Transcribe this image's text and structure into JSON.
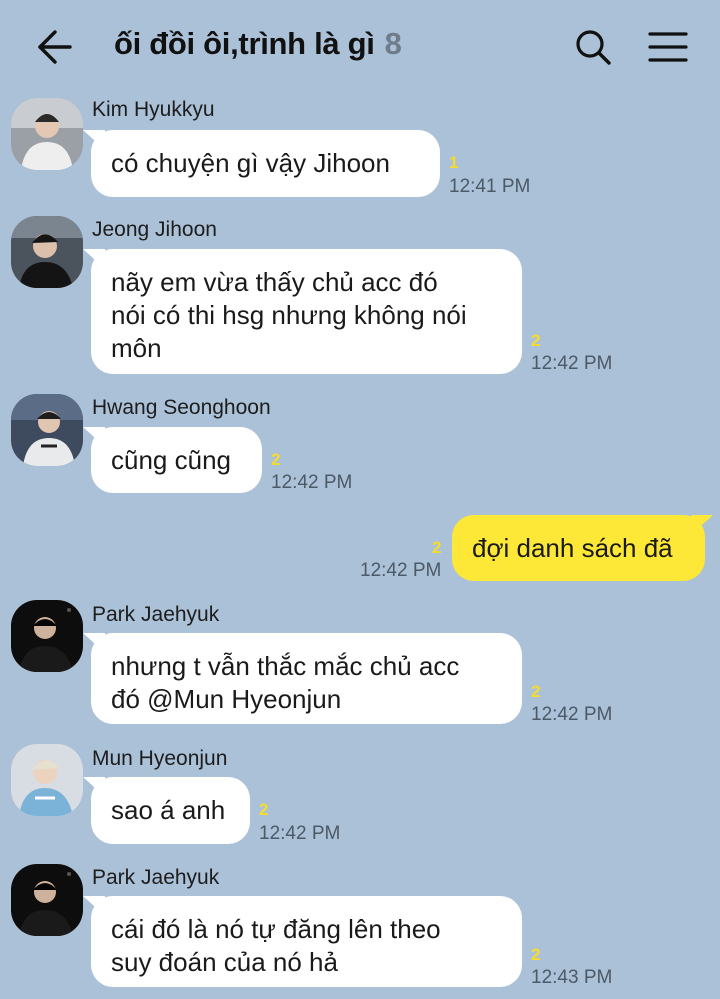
{
  "header": {
    "title": "ối đồi ôi,trình là gì",
    "member_count": "8",
    "back_icon": "arrow-left-icon",
    "search_icon": "search-icon",
    "menu_icon": "hamburger-menu-icon"
  },
  "colors": {
    "background": "#abc1d8",
    "incoming_bubble": "#ffffff",
    "outgoing_bubble": "#fee837",
    "unread_count": "#f7dc2a"
  },
  "messages": [
    {
      "sender": "Kim Hyukkyu",
      "lines": [
        "có chuyện gì vậy Jihoon"
      ],
      "unread": "1",
      "time": "12:41 PM",
      "direction": "incoming"
    },
    {
      "sender": "Jeong Jihoon",
      "lines": [
        "nãy em vừa thấy chủ acc đó",
        "nói có thi hsg nhưng không nói",
        "môn"
      ],
      "unread": "2",
      "time": "12:42 PM",
      "direction": "incoming"
    },
    {
      "sender": "Hwang Seonghoon",
      "lines": [
        "cũng cũng"
      ],
      "unread": "2",
      "time": "12:42 PM",
      "direction": "incoming"
    },
    {
      "sender": "",
      "lines": [
        "đợi danh sách đã"
      ],
      "unread": "2",
      "time": "12:42 PM",
      "direction": "outgoing"
    },
    {
      "sender": "Park Jaehyuk",
      "lines": [
        "nhưng t vẫn thắc mắc chủ acc",
        "đó @Mun Hyeonjun"
      ],
      "unread": "2",
      "time": "12:42 PM",
      "direction": "incoming"
    },
    {
      "sender": "Mun Hyeonjun",
      "lines": [
        "sao á anh"
      ],
      "unread": "2",
      "time": "12:42 PM",
      "direction": "incoming"
    },
    {
      "sender": "Park Jaehyuk",
      "lines": [
        "cái đó là nó tự đăng lên theo",
        "suy đoán của nó hả"
      ],
      "unread": "2",
      "time": "12:43 PM",
      "direction": "incoming"
    }
  ]
}
